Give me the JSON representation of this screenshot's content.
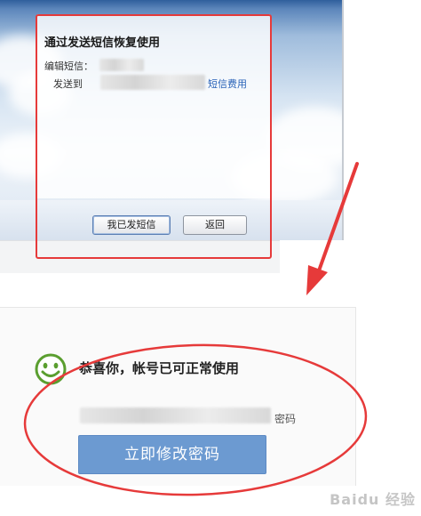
{
  "sms_dialog": {
    "title": "通过发送短信恢复使用",
    "edit_label": "编辑短信：",
    "send_to_label": "发送到",
    "fee_link": "短信费用",
    "sent_button": "我已发短信",
    "back_button": "返回"
  },
  "success_dialog": {
    "title": "恭喜你，帐号已可正常使用",
    "password_suffix": "密码",
    "change_password_button": "立即修改密码"
  },
  "watermark": "Baidu 经验",
  "colors": {
    "annotation_red": "#e63a3a",
    "link_blue": "#2a63b8",
    "primary_button": "#6c9ad1",
    "smile_green": "#5a9e2f"
  }
}
